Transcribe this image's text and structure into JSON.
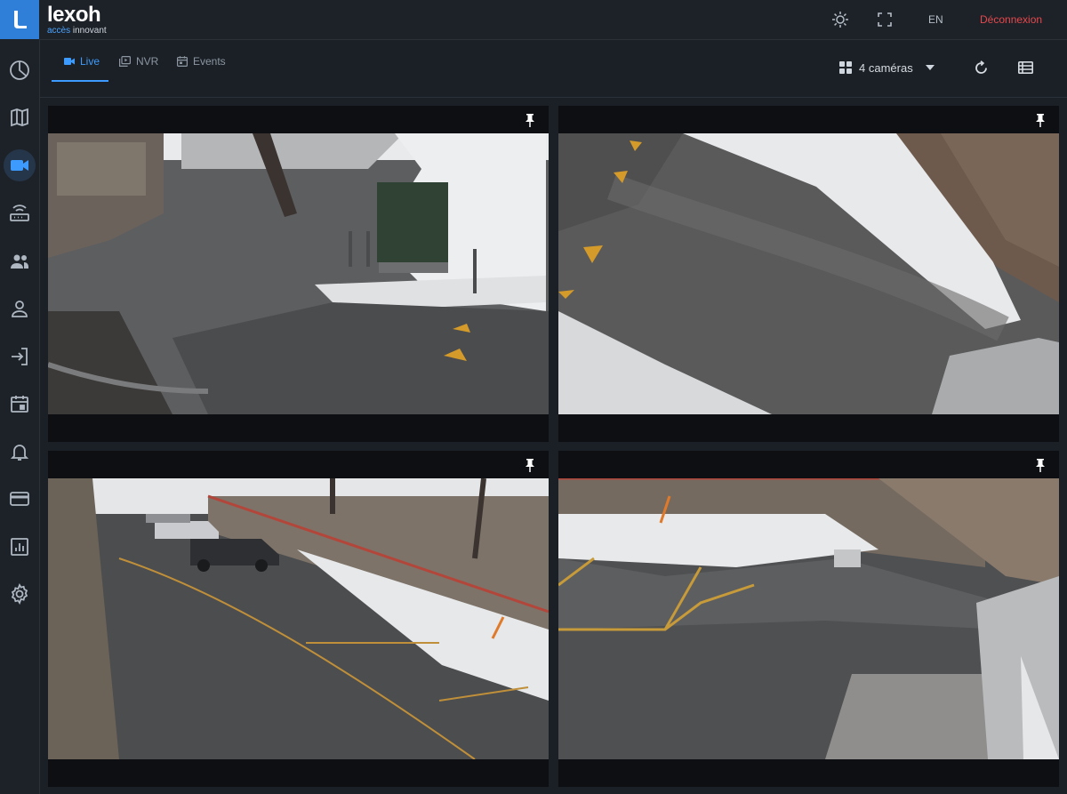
{
  "app": {
    "brand_name": "lexoh",
    "tagline_accent": "accès",
    "tagline_rest": " innovant",
    "accent_color": "#2f7fd8"
  },
  "topbar": {
    "language": "EN",
    "logout": "Déconnexion",
    "icons": [
      "brightness-icon",
      "fullscreen-icon"
    ]
  },
  "sidebar": {
    "items": [
      {
        "icon": "dashboard-icon",
        "active": false
      },
      {
        "icon": "map-icon",
        "active": false
      },
      {
        "icon": "camera-icon",
        "active": true
      },
      {
        "icon": "router-icon",
        "active": false
      },
      {
        "icon": "users-icon",
        "active": false
      },
      {
        "icon": "user-icon",
        "active": false
      },
      {
        "icon": "login-icon",
        "active": false
      },
      {
        "icon": "calendar-icon",
        "active": false
      },
      {
        "icon": "bell-icon",
        "active": false
      },
      {
        "icon": "card-icon",
        "active": false
      },
      {
        "icon": "report-icon",
        "active": false
      },
      {
        "icon": "settings-icon",
        "active": false
      }
    ]
  },
  "tabs": [
    {
      "label": "Live",
      "icon": "video-icon",
      "active": true
    },
    {
      "label": "NVR",
      "icon": "recordings-icon",
      "active": false
    },
    {
      "label": "Events",
      "icon": "events-icon",
      "active": false
    }
  ],
  "toolbar": {
    "camera_select": "4 cameras_placeholder",
    "camera_select_label": "4 caméras",
    "icons": [
      "grid-icon",
      "chevron-down-icon",
      "refresh-icon",
      "list-view-icon"
    ]
  },
  "cameras": [
    {
      "scene": "snowy courtyard with utility box and tree",
      "pinned": false
    },
    {
      "scene": "snowy driveway with cones and building",
      "pinned": false
    },
    {
      "scene": "parking lot with parked cars and stone wall",
      "pinned": false
    },
    {
      "scene": "parking area with stone wall and building",
      "pinned": false
    }
  ]
}
